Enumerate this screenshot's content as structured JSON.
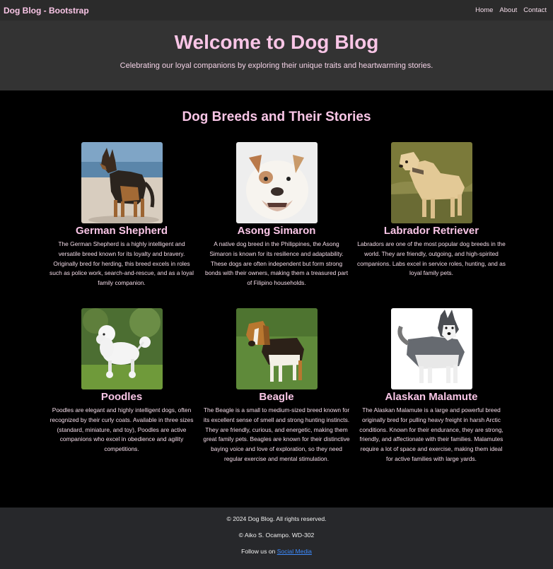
{
  "navbar": {
    "brand": "Dog Blog - Bootstrap",
    "links": [
      "Home",
      "About",
      "Contact"
    ]
  },
  "hero": {
    "title": "Welcome to Dog Blog",
    "subtitle": "Celebrating our loyal companions by exploring their unique traits and heartwarming stories."
  },
  "main": {
    "section_title": "Dog Breeds and Their Stories",
    "breeds": [
      {
        "name": "German Shepherd",
        "description": "The German Shepherd is a highly intelligent and versatile breed known for its loyalty and bravery. Originally bred for herding, this breed excels in roles such as police work, search-and-rescue, and as a loyal family companion."
      },
      {
        "name": "Asong Simaron",
        "description": "A native dog breed in the Philippines, the Asong Simaron is known for its resilience and adaptability. These dogs are often independent but form strong bonds with their owners, making them a treasured part of Filipino households."
      },
      {
        "name": "Labrador Retriever",
        "description": "Labradors are one of the most popular dog breeds in the world. They are friendly, outgoing, and high-spirited companions. Labs excel in service roles, hunting, and as loyal family pets."
      },
      {
        "name": "Poodles",
        "description": "Poodles are elegant and highly intelligent dogs, often recognized by their curly coats. Available in three sizes (standard, miniature, and toy), Poodles are active companions who excel in obedience and agility competitions."
      },
      {
        "name": "Beagle",
        "description": "The Beagle is a small to medium-sized breed known for its excellent sense of smell and strong hunting instincts. They are friendly, curious, and energetic, making them great family pets. Beagles are known for their distinctive baying voice and love of exploration, so they need regular exercise and mental stimulation."
      },
      {
        "name": "Alaskan Malamute",
        "description": "The Alaskan Malamute is a large and powerful breed originally bred for pulling heavy freight in harsh Arctic conditions. Known for their endurance, they are strong, friendly, and affectionate with their families. Malamutes require a lot of space and exercise, making them ideal for active families with large yards."
      }
    ]
  },
  "footer": {
    "copyright": "© 2024 Dog Blog. All rights reserved.",
    "author": "© Aiko S. Ocampo. WD-302",
    "follow_prefix": "Follow us on ",
    "follow_link": "Social Media"
  },
  "colors": {
    "accent_pink": "#f9c5e6",
    "navbar_bg": "#2b2b2b",
    "hero_bg": "#333333",
    "body_bg": "#000000",
    "footer_bg": "#27282b",
    "link_blue": "#3d8bfd"
  }
}
